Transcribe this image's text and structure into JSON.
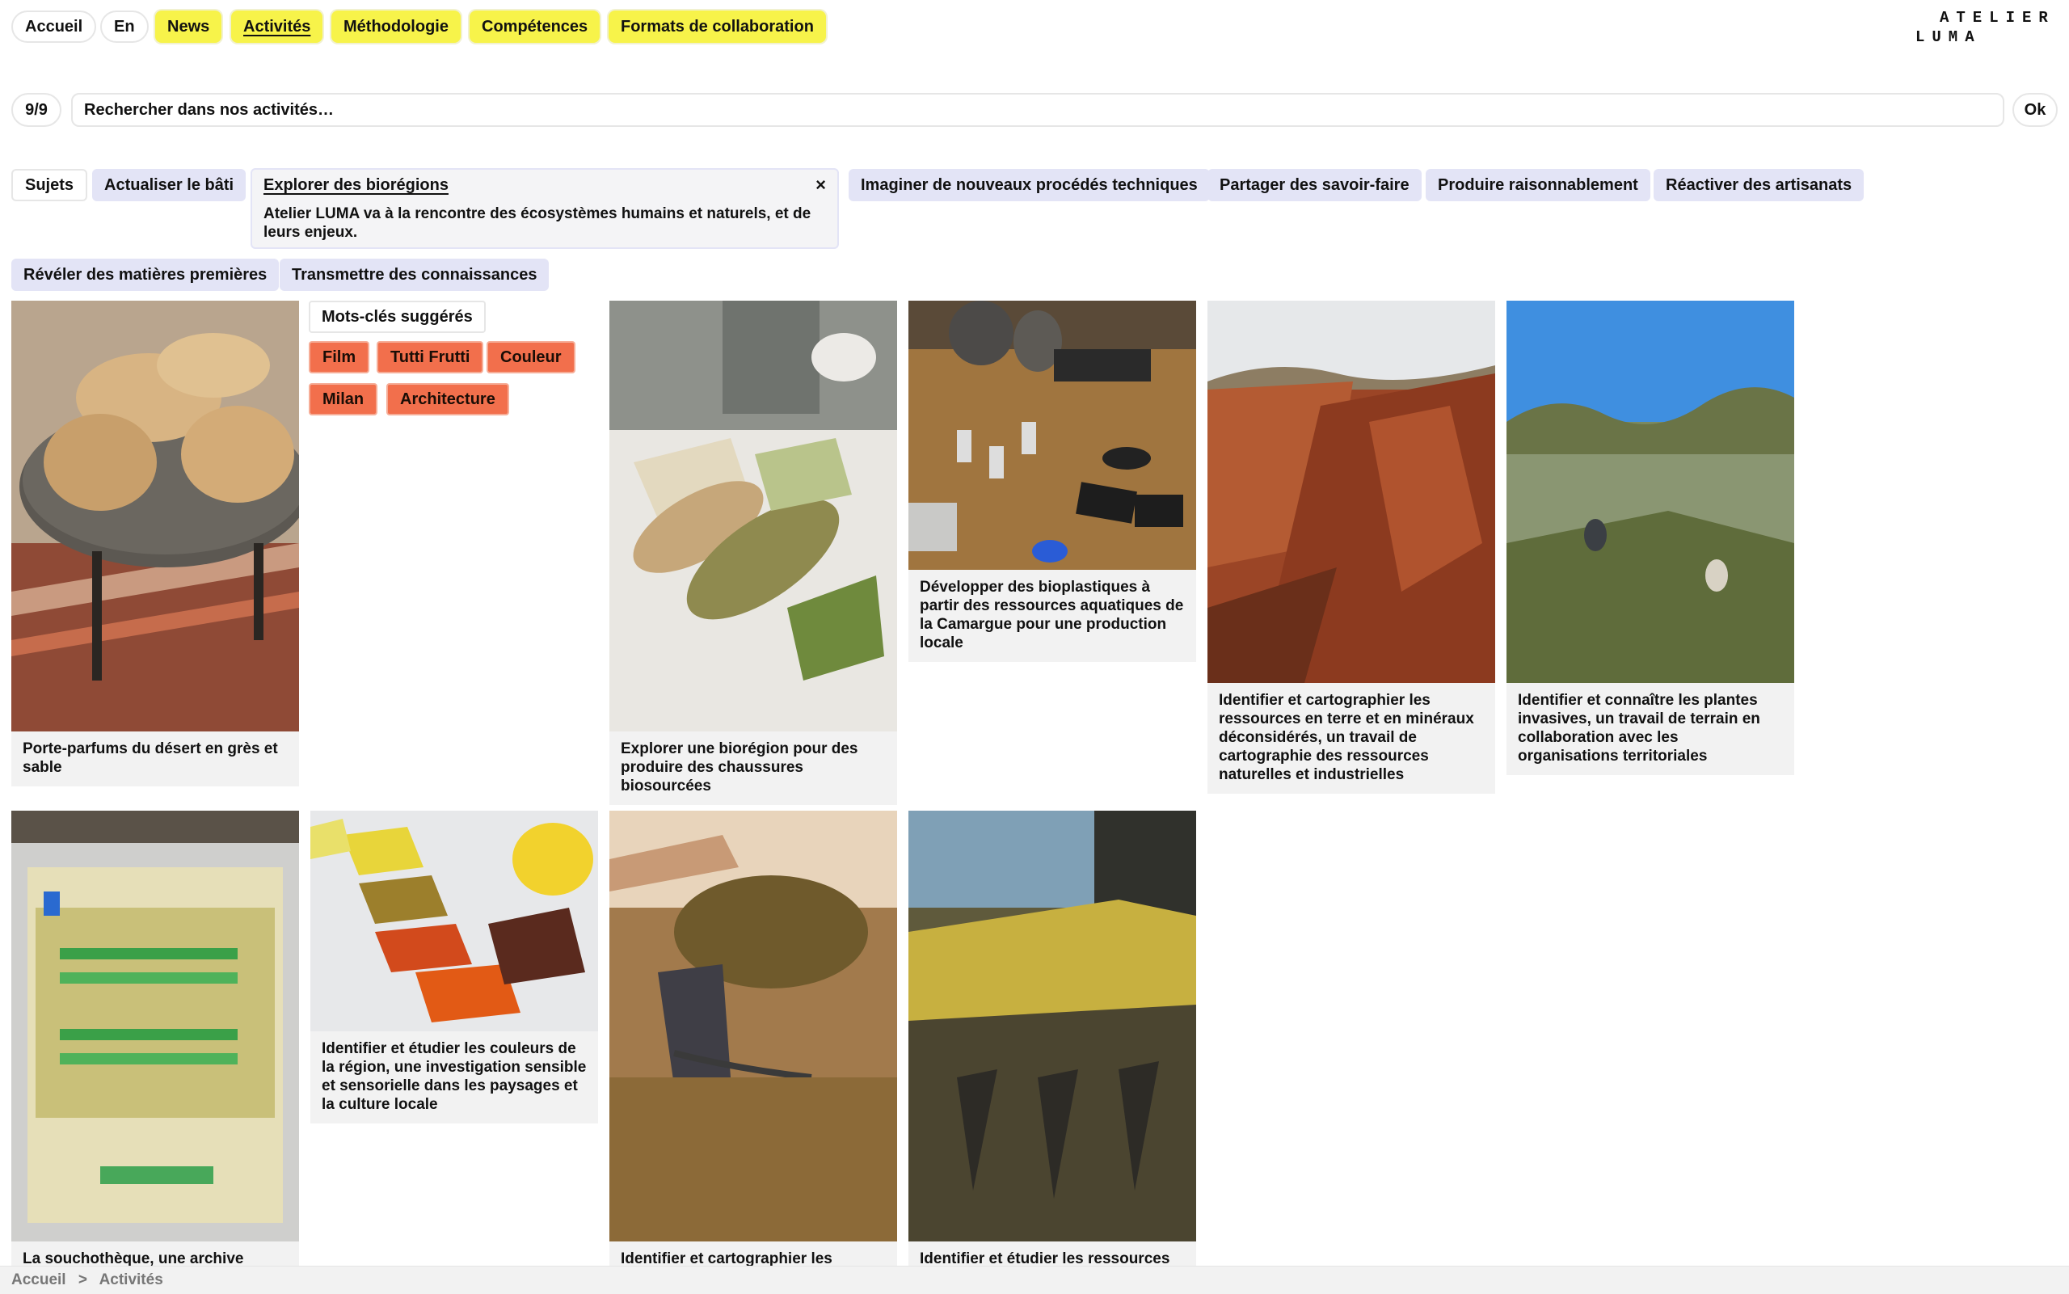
{
  "nav": {
    "home": "Accueil",
    "lang": "En",
    "news": "News",
    "activities": "Activités",
    "methodology": "Méthodologie",
    "skills": "Compétences",
    "collab": "Formats de collaboration"
  },
  "logo": {
    "line1": "ATELIER",
    "line2": "LUMA"
  },
  "search": {
    "count": "9/9",
    "placeholder": "Rechercher dans nos activités…",
    "ok": "Ok"
  },
  "subjects": {
    "label": "Sujets",
    "items": [
      "Actualiser le bâti",
      "Explorer des biorégions",
      "Imaginer de nouveaux procédés techniques",
      "Partager des savoir-faire",
      "Produire raisonnablement",
      "Réactiver des artisanats",
      "Révéler des matières premières",
      "Transmettre des connaissances"
    ],
    "expanded_description": "Atelier LUMA va à la rencontre des écosystèmes humains et naturels, et de leurs enjeux.",
    "close": "×"
  },
  "keywords": {
    "label": "Mots-clés suggérés",
    "items": [
      "Film",
      "Tutti Frutti",
      "Couleur",
      "Milan",
      "Architecture"
    ]
  },
  "cards": [
    {
      "caption": "Porte-parfums du désert en grès et sable",
      "image": "wooden-dishes-photo"
    },
    {
      "caption": "Explorer une biorégion pour des produire des chaussures biosourcées",
      "image": "woven-shoes-photo"
    },
    {
      "caption": "Développer des bioplastiques à partir des ressources aquatiques de la Camargue pour une production locale",
      "image": "lab-table-photo"
    },
    {
      "caption": "Identifier et cartographier les ressources en terre et en minéraux déconsidérés, un travail de cartographie des ressources naturelles et industrielles",
      "image": "red-earth-photo"
    },
    {
      "caption": "Identifier et connaître les plantes invasives, un travail de terrain en collaboration avec les organisations territoriales",
      "image": "wetland-photo"
    },
    {
      "caption": "La souchothèque, une archive",
      "image": "incubator-photo"
    },
    {
      "caption": "Identifier et étudier les couleurs de la région, une investigation sensible et sensorielle dans les paysages et la culture locale",
      "image": "color-swatches-photo"
    },
    {
      "caption": "Identifier et cartographier les",
      "image": "reed-harvest-photo"
    },
    {
      "caption": "Identifier et étudier les ressources",
      "image": "harvester-photo"
    }
  ],
  "breadcrumb": {
    "home": "Accueil",
    "sep": ">",
    "current": "Activités"
  }
}
